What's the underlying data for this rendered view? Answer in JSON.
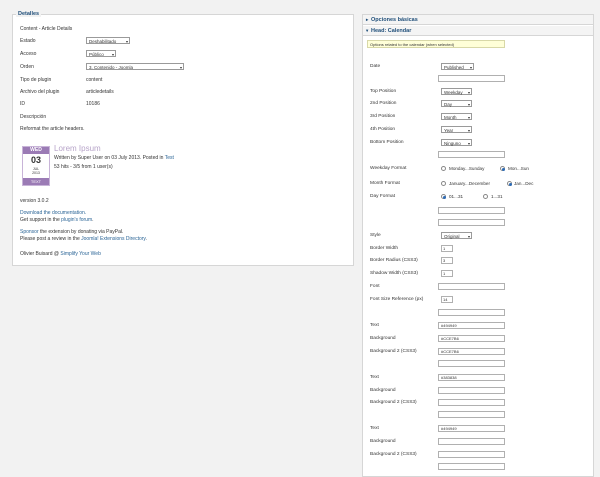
{
  "left": {
    "legend": "Detalles",
    "subtitle": "Content - Article Details",
    "fields": [
      {
        "label": "Estado",
        "value": "Deshabilitado"
      },
      {
        "label": "Acceso",
        "value": "Público"
      },
      {
        "label": "Orden",
        "value": "3. Contenido - Joomla"
      },
      {
        "label": "Tipo de plugin",
        "value": "content"
      },
      {
        "label": "Archivo del plugin",
        "value": "articledetails"
      },
      {
        "label": "ID",
        "value": "10186"
      }
    ],
    "description_label": "Descripción",
    "description": "Reformat the article headers.",
    "calendar": {
      "weekday": "WED",
      "day": "03",
      "month": "JUL",
      "year": "2013",
      "bottom": "TEXT"
    },
    "article_title": "Lorem Ipsum",
    "written_by": "Written by Super User on 03 July 2013. Posted in",
    "written_link": "Test",
    "hits": "53 hits - 3/5 from 1 user(s)",
    "version": "version 3.0.2",
    "download": "Download the documentation.",
    "support_prefix": "Get support in the ",
    "support_link": "plugin's forum",
    "sponsor_link": "Sponsor",
    "sponsor_text": " the extension by donating via PayPal.",
    "review_prefix": "Please post a review in the ",
    "review_link": "Joomla! Extensions Directory",
    "author_prefix": "Olivier Buisard @ ",
    "author_link": "Simplify Your Web"
  },
  "right": {
    "panel1_title": "Opciones básicas",
    "panel2_title": "Head: Calendar",
    "hint": "Options related to the calendar (when selected)",
    "date_label": "Date",
    "date_value": "Published",
    "top_label": "Top Position",
    "top_value": "Weekday",
    "p2_label": "2nd Position",
    "p2_value": "Day",
    "p3_label": "3rd Position",
    "p3_value": "Month",
    "p4_label": "4th Position",
    "p4_value": "Year",
    "bottom_label": "Bottom Position",
    "bottom_value": "Ninguno",
    "weekday_label": "Weekday Format",
    "weekday_opt1": "Monday...Sunday",
    "weekday_opt2": "Mon...Sun",
    "month_label": "Month Format",
    "month_opt1": "January...December",
    "month_opt2": "Jan...Dec",
    "day_label": "Day Format",
    "day_opt1": "01...31",
    "day_opt2": "1...31",
    "style_label": "Style",
    "style_value": "Original",
    "bw_label": "Border Width",
    "bw_value": "1",
    "br_label": "Border Radius (CSS3)",
    "br_value": "3",
    "sw_label": "Shadow Width (CSS3)",
    "sw_value": "1",
    "font_label": "Font",
    "fsr_label": "Font Size Reference (px)",
    "fsr_value": "14",
    "text1_label": "Text",
    "text1_value": "#494949",
    "bg1_label": "Background",
    "bg1_value": "#CCE7B6",
    "bg21_label": "Background 2 (CSS3)",
    "bg21_value": "#CCE7B6",
    "text2_label": "Text",
    "text2_value": "#383838",
    "bg2_label": "Background",
    "bg22_label": "Background 2 (CSS3)",
    "text3_label": "Text",
    "text3_value": "#494949",
    "bg3_label": "Background",
    "bg23_label": "Background 2 (CSS3)"
  }
}
